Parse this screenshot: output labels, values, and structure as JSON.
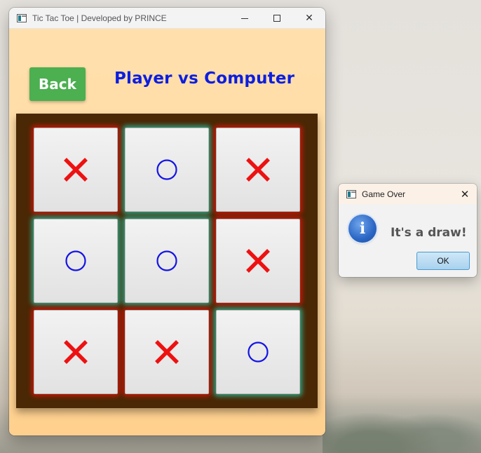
{
  "window": {
    "title": "Tic Tac Toe | Developed by PRINCE",
    "icon": "app-window-icon",
    "controls": [
      "minimize-icon",
      "maximize-icon",
      "close-icon"
    ]
  },
  "header": {
    "back_label": "Back",
    "mode_title": "Player vs Computer"
  },
  "board": {
    "cells": [
      {
        "mark": "X"
      },
      {
        "mark": "O"
      },
      {
        "mark": "X"
      },
      {
        "mark": "O"
      },
      {
        "mark": "O"
      },
      {
        "mark": "X"
      },
      {
        "mark": "X"
      },
      {
        "mark": "X"
      },
      {
        "mark": "O"
      }
    ]
  },
  "dialog": {
    "title": "Game Over",
    "message": "It's a draw!",
    "ok_label": "OK",
    "icon": "info-icon"
  },
  "colors": {
    "x_mark": "#ee1111",
    "o_mark": "#1414e6",
    "back_button": "#4caf50",
    "title_text": "#0c1ee0",
    "board_bg": "#4a2805",
    "content_bg": "#ffdba4"
  }
}
